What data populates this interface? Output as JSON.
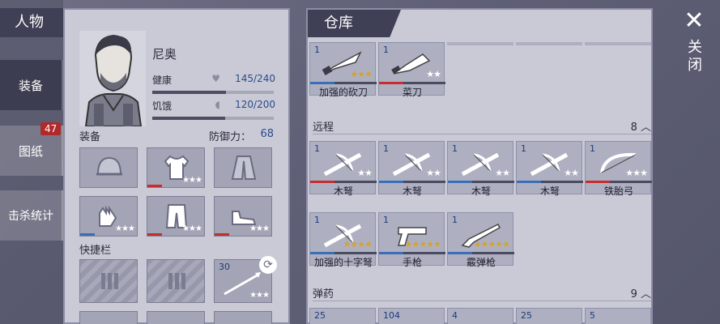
{
  "nav": {
    "title": "人物",
    "items": [
      {
        "label": "装备",
        "active": true
      },
      {
        "label": "图纸",
        "badge": "47"
      },
      {
        "label": "击杀统计"
      }
    ]
  },
  "character": {
    "name": "尼奥",
    "health_label": "健康",
    "health_value": "145/240",
    "health_fraction": 0.604,
    "hunger_label": "饥饿",
    "hunger_value": "120/200",
    "hunger_fraction": 0.6,
    "equip_label": "装备",
    "defense_label": "防御力：",
    "defense_value": "68",
    "quickbar_label": "快捷栏",
    "quickbar_slot_qty": "30"
  },
  "warehouse": {
    "title": "仓库",
    "melee": [
      {
        "count": "1",
        "name": "加强的砍刀",
        "stars": 3,
        "bar": "#3a6fb8"
      },
      {
        "count": "1",
        "name": "菜刀",
        "stars": 2,
        "bar": "#c62d2d"
      }
    ],
    "ranged_label": "远程",
    "ranged_count": "8",
    "ranged": [
      {
        "count": "1",
        "name": "木弩",
        "stars": 2,
        "bar": "#c62d2d"
      },
      {
        "count": "1",
        "name": "木弩",
        "stars": 2,
        "bar": "#3a6fb8"
      },
      {
        "count": "1",
        "name": "木弩",
        "stars": 2,
        "bar": "#3a6fb8"
      },
      {
        "count": "1",
        "name": "木弩",
        "stars": 2,
        "bar": "#3a6fb8"
      },
      {
        "count": "1",
        "name": "铁胎弓",
        "stars": 3,
        "bar": "#c62d2d"
      },
      {
        "count": "1",
        "name": "加强的十字弩",
        "stars": 4,
        "bar": "#3a6fb8"
      },
      {
        "count": "1",
        "name": "手枪",
        "stars": 5,
        "bar": "#3a6fb8"
      },
      {
        "count": "1",
        "name": "霰弹枪",
        "stars": 5,
        "bar": "#3a6fb8"
      }
    ],
    "ammo_label": "弹药",
    "ammo_count": "9",
    "ammo": [
      {
        "count": "25"
      },
      {
        "count": "104"
      },
      {
        "count": "4"
      },
      {
        "count": "25"
      },
      {
        "count": "5"
      }
    ]
  },
  "close_label": "关闭"
}
